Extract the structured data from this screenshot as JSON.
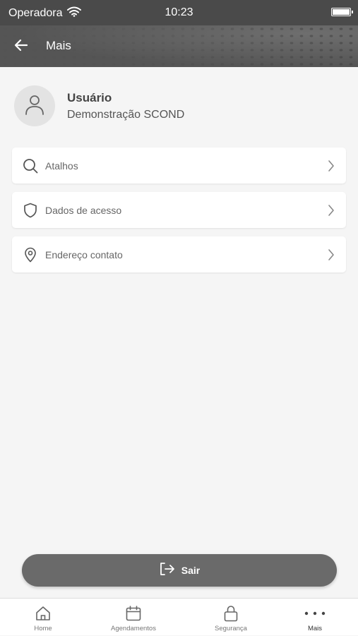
{
  "status_bar": {
    "carrier": "Operadora",
    "time": "10:23"
  },
  "header": {
    "title": "Mais"
  },
  "profile": {
    "name": "Usuário",
    "subtitle": "Demonstração SCOND"
  },
  "menu": {
    "items": [
      {
        "label": "Atalhos",
        "icon": "search-icon"
      },
      {
        "label": "Dados de acesso",
        "icon": "shield-icon"
      },
      {
        "label": "Endereço contato",
        "icon": "location-pin-icon"
      }
    ]
  },
  "logout": {
    "label": "Sair",
    "icon": "logout-icon"
  },
  "tabs": [
    {
      "label": "Home",
      "icon": "home-icon"
    },
    {
      "label": "Agendamentos",
      "icon": "calendar-icon"
    },
    {
      "label": "Segurança",
      "icon": "lock-icon"
    },
    {
      "label": "Mais",
      "icon": "more-dots-icon",
      "active": true
    }
  ],
  "colors": {
    "header_bg": "#5a5a5a",
    "status_bar_bg": "#4a4a4a",
    "page_bg": "#f5f5f5",
    "logout_bg": "#6a6a6a"
  }
}
